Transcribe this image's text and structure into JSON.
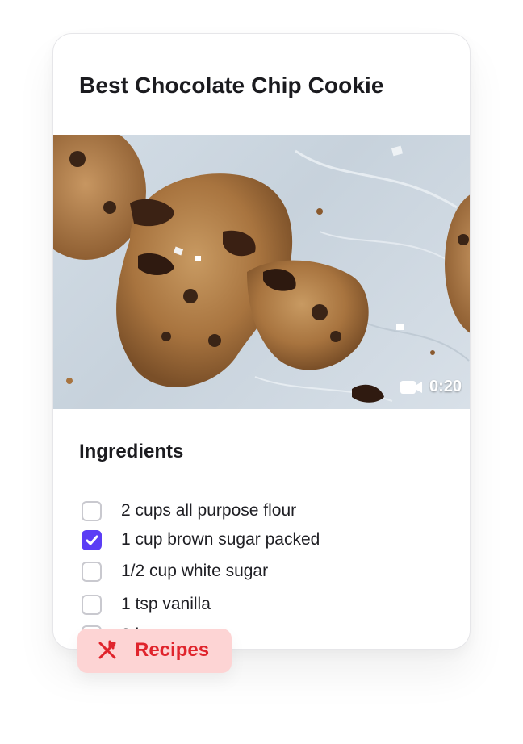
{
  "card": {
    "title": "Best Chocolate Chip Cookie",
    "media": {
      "image": "chocolate-chip-cookies-photo",
      "video_icon": "video-camera-icon",
      "duration": "0:20"
    },
    "ingredients": {
      "heading": "Ingredients",
      "items": [
        {
          "label": "2 cups all purpose flour",
          "checked": false
        },
        {
          "label": "1 cup brown sugar packed",
          "checked": true
        },
        {
          "label": "1/2 cup white sugar",
          "checked": false
        },
        {
          "label": "1 tsp vanilla",
          "checked": false
        },
        {
          "label": "2 large eggs",
          "checked": false
        }
      ]
    }
  },
  "tag": {
    "icon": "fork-knife-icon",
    "label": "Recipes"
  },
  "colors": {
    "accent": "#5b3df5",
    "tag_bg": "#fdd4d4",
    "tag_text": "#e0242c",
    "text": "#1b1b1f"
  }
}
